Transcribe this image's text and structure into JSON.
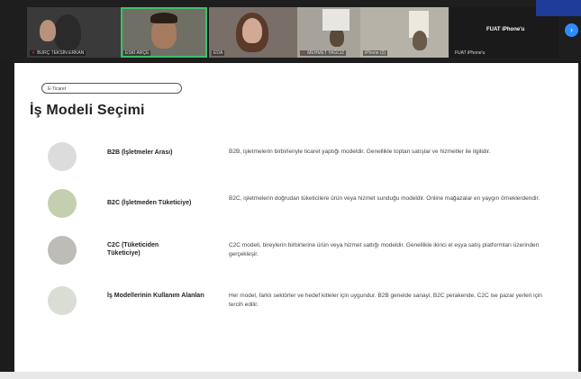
{
  "participants": [
    {
      "name": "BURÇ TEKSİN ERKAN",
      "muted": true,
      "bg": "#3a3a3a",
      "skin": "#b8927a"
    },
    {
      "name": "ESKİ ARÇE",
      "muted": false,
      "bg": "#6f6f66",
      "skin": "#a57a5e",
      "active": true
    },
    {
      "name": "EDA",
      "muted": false,
      "bg": "#7a6e68",
      "skin": "#d2a994"
    },
    {
      "name": "MEHMET YAĞCIZ",
      "muted": true,
      "bg": "#a8a39a",
      "skin": "#5a4a3a"
    },
    {
      "name": "iPhone (2)",
      "muted": false,
      "bg": "#b7b2a8",
      "skin": "#6a5a4a"
    },
    {
      "name": "FUAT iPhone'u",
      "muted": false,
      "bg": "#1a1a1a",
      "label": "FUAT iPhone'u"
    }
  ],
  "next_icon": "chevron-right-icon",
  "slide": {
    "breadcrumb": "E-Ticaret",
    "title": "İş Modeli Seçimi",
    "items": [
      {
        "term": "B2B (İşletmeler Arası)",
        "desc": "B2B, işletmelerin birbirleriyle ticaret yaptığı modeldir. Genellikle toptan satışlar ve hizmetler ile ilgilidir.",
        "color": "#dcdcdc"
      },
      {
        "term": "B2C (İşletmeden Tüketiciye)",
        "desc": "B2C, işletmelerin doğrudan tüketicilere ürün veya hizmet sunduğu modeldir. Online mağazalar en yaygın örneklerdendir.",
        "color": "#c4cfb0"
      },
      {
        "term": "C2C (Tüketiciden Tüketiciye)",
        "desc": "C2C modeli, bireylerin birbirlerine ürün veya hizmet sattığı modeldir. Genellikle ikinci el eşya satış platformları üzerinden gerçekleşir.",
        "color": "#bdbcb6"
      },
      {
        "term": "İş Modellerinin Kullanım Alanları",
        "desc": "Her model, farklı sektörler ve hedef kitleler için uygundur. B2B genelde sanayi, B2C perakende, C2C ise pazar yerleri için tercih edilir.",
        "color": "#d9ddd4"
      }
    ]
  }
}
